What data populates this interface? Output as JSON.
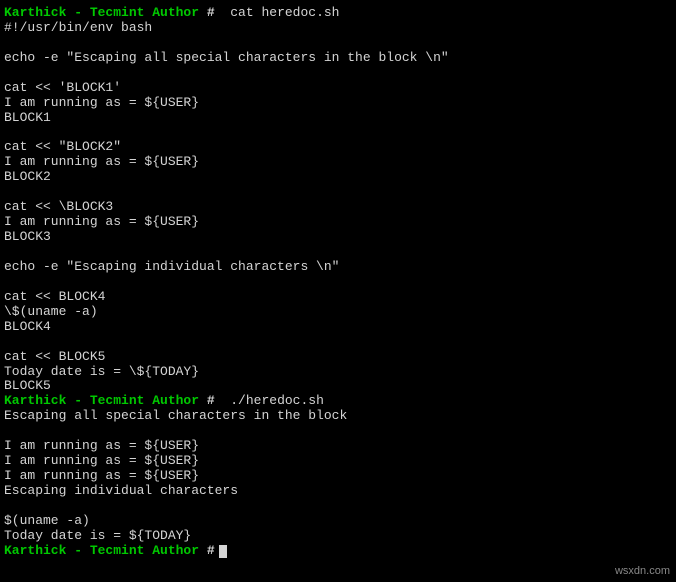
{
  "prompt": "Karthick - Tecmint Author ",
  "hash": "#",
  "cmd1": "  cat heredoc.sh",
  "file": {
    "l1": "#!/usr/bin/env bash",
    "l2": "",
    "l3": "echo -e \"Escaping all special characters in the block \\n\"",
    "l4": "",
    "l5": "cat << 'BLOCK1'",
    "l6": "I am running as = ${USER}",
    "l7": "BLOCK1",
    "l8": "",
    "l9": "cat << \"BLOCK2\"",
    "l10": "I am running as = ${USER}",
    "l11": "BLOCK2",
    "l12": "",
    "l13": "cat << \\BLOCK3",
    "l14": "I am running as = ${USER}",
    "l15": "BLOCK3",
    "l16": "",
    "l17": "echo -e \"Escaping individual characters \\n\"",
    "l18": "",
    "l19": "cat << BLOCK4",
    "l20": "\\$(uname -a)",
    "l21": "BLOCK4",
    "l22": "",
    "l23": "cat << BLOCK5",
    "l24": "Today date is = \\${TODAY}",
    "l25": "BLOCK5"
  },
  "cmd2": "  ./heredoc.sh",
  "out": {
    "l1": "Escaping all special characters in the block",
    "l2": "",
    "l3": "I am running as = ${USER}",
    "l4": "I am running as = ${USER}",
    "l5": "I am running as = ${USER}",
    "l6": "Escaping individual characters",
    "l7": "",
    "l8": "$(uname -a)",
    "l9": "Today date is = ${TODAY}"
  },
  "watermark": "wsxdn.com"
}
